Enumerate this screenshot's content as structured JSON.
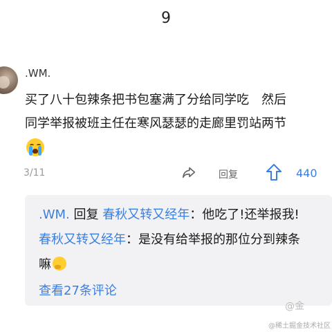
{
  "page_number": "9",
  "comment": {
    "username": ".WM.",
    "text_line1": "买了八十包辣条把书包塞满了分给同学吃　然后",
    "text_line2": "同学举报被班主任在寒风瑟瑟的走廊里罚站两节",
    "date": "3/11",
    "reply_label": "回复",
    "vote_count": "440"
  },
  "replies": [
    {
      "author": ".WM.",
      "reply_word": "回复",
      "target": "春秋又转又经年",
      "text": "：他吃了!还举报我!"
    },
    {
      "author": "春秋又转又经年",
      "text": "：是没有给举报的那位分到辣条",
      "text_cont": "嘛"
    }
  ],
  "view_all_label": "查看27条评论",
  "weibo_mark": "@金",
  "watermark": "@稀土掘金技术社区",
  "colors": {
    "link_blue": "#3a7fe0",
    "reply_bg": "#f2f2f4"
  }
}
